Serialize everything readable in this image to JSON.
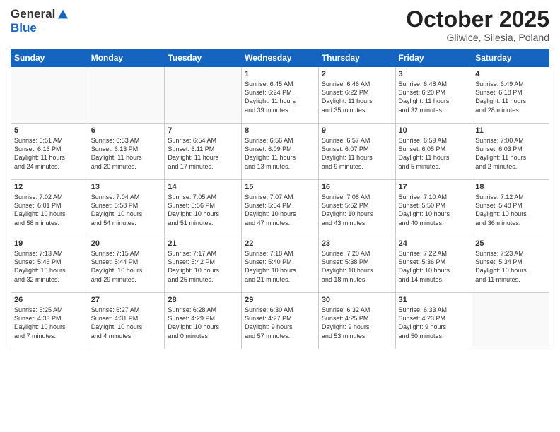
{
  "header": {
    "logo_line1": "General",
    "logo_line2": "Blue",
    "month": "October 2025",
    "location": "Gliwice, Silesia, Poland"
  },
  "weekdays": [
    "Sunday",
    "Monday",
    "Tuesday",
    "Wednesday",
    "Thursday",
    "Friday",
    "Saturday"
  ],
  "weeks": [
    [
      {
        "day": "",
        "info": ""
      },
      {
        "day": "",
        "info": ""
      },
      {
        "day": "",
        "info": ""
      },
      {
        "day": "1",
        "info": "Sunrise: 6:45 AM\nSunset: 6:24 PM\nDaylight: 11 hours\nand 39 minutes."
      },
      {
        "day": "2",
        "info": "Sunrise: 6:46 AM\nSunset: 6:22 PM\nDaylight: 11 hours\nand 35 minutes."
      },
      {
        "day": "3",
        "info": "Sunrise: 6:48 AM\nSunset: 6:20 PM\nDaylight: 11 hours\nand 32 minutes."
      },
      {
        "day": "4",
        "info": "Sunrise: 6:49 AM\nSunset: 6:18 PM\nDaylight: 11 hours\nand 28 minutes."
      }
    ],
    [
      {
        "day": "5",
        "info": "Sunrise: 6:51 AM\nSunset: 6:16 PM\nDaylight: 11 hours\nand 24 minutes."
      },
      {
        "day": "6",
        "info": "Sunrise: 6:53 AM\nSunset: 6:13 PM\nDaylight: 11 hours\nand 20 minutes."
      },
      {
        "day": "7",
        "info": "Sunrise: 6:54 AM\nSunset: 6:11 PM\nDaylight: 11 hours\nand 17 minutes."
      },
      {
        "day": "8",
        "info": "Sunrise: 6:56 AM\nSunset: 6:09 PM\nDaylight: 11 hours\nand 13 minutes."
      },
      {
        "day": "9",
        "info": "Sunrise: 6:57 AM\nSunset: 6:07 PM\nDaylight: 11 hours\nand 9 minutes."
      },
      {
        "day": "10",
        "info": "Sunrise: 6:59 AM\nSunset: 6:05 PM\nDaylight: 11 hours\nand 5 minutes."
      },
      {
        "day": "11",
        "info": "Sunrise: 7:00 AM\nSunset: 6:03 PM\nDaylight: 11 hours\nand 2 minutes."
      }
    ],
    [
      {
        "day": "12",
        "info": "Sunrise: 7:02 AM\nSunset: 6:01 PM\nDaylight: 10 hours\nand 58 minutes."
      },
      {
        "day": "13",
        "info": "Sunrise: 7:04 AM\nSunset: 5:58 PM\nDaylight: 10 hours\nand 54 minutes."
      },
      {
        "day": "14",
        "info": "Sunrise: 7:05 AM\nSunset: 5:56 PM\nDaylight: 10 hours\nand 51 minutes."
      },
      {
        "day": "15",
        "info": "Sunrise: 7:07 AM\nSunset: 5:54 PM\nDaylight: 10 hours\nand 47 minutes."
      },
      {
        "day": "16",
        "info": "Sunrise: 7:08 AM\nSunset: 5:52 PM\nDaylight: 10 hours\nand 43 minutes."
      },
      {
        "day": "17",
        "info": "Sunrise: 7:10 AM\nSunset: 5:50 PM\nDaylight: 10 hours\nand 40 minutes."
      },
      {
        "day": "18",
        "info": "Sunrise: 7:12 AM\nSunset: 5:48 PM\nDaylight: 10 hours\nand 36 minutes."
      }
    ],
    [
      {
        "day": "19",
        "info": "Sunrise: 7:13 AM\nSunset: 5:46 PM\nDaylight: 10 hours\nand 32 minutes."
      },
      {
        "day": "20",
        "info": "Sunrise: 7:15 AM\nSunset: 5:44 PM\nDaylight: 10 hours\nand 29 minutes."
      },
      {
        "day": "21",
        "info": "Sunrise: 7:17 AM\nSunset: 5:42 PM\nDaylight: 10 hours\nand 25 minutes."
      },
      {
        "day": "22",
        "info": "Sunrise: 7:18 AM\nSunset: 5:40 PM\nDaylight: 10 hours\nand 21 minutes."
      },
      {
        "day": "23",
        "info": "Sunrise: 7:20 AM\nSunset: 5:38 PM\nDaylight: 10 hours\nand 18 minutes."
      },
      {
        "day": "24",
        "info": "Sunrise: 7:22 AM\nSunset: 5:36 PM\nDaylight: 10 hours\nand 14 minutes."
      },
      {
        "day": "25",
        "info": "Sunrise: 7:23 AM\nSunset: 5:34 PM\nDaylight: 10 hours\nand 11 minutes."
      }
    ],
    [
      {
        "day": "26",
        "info": "Sunrise: 6:25 AM\nSunset: 4:33 PM\nDaylight: 10 hours\nand 7 minutes."
      },
      {
        "day": "27",
        "info": "Sunrise: 6:27 AM\nSunset: 4:31 PM\nDaylight: 10 hours\nand 4 minutes."
      },
      {
        "day": "28",
        "info": "Sunrise: 6:28 AM\nSunset: 4:29 PM\nDaylight: 10 hours\nand 0 minutes."
      },
      {
        "day": "29",
        "info": "Sunrise: 6:30 AM\nSunset: 4:27 PM\nDaylight: 9 hours\nand 57 minutes."
      },
      {
        "day": "30",
        "info": "Sunrise: 6:32 AM\nSunset: 4:25 PM\nDaylight: 9 hours\nand 53 minutes."
      },
      {
        "day": "31",
        "info": "Sunrise: 6:33 AM\nSunset: 4:23 PM\nDaylight: 9 hours\nand 50 minutes."
      },
      {
        "day": "",
        "info": ""
      }
    ]
  ]
}
